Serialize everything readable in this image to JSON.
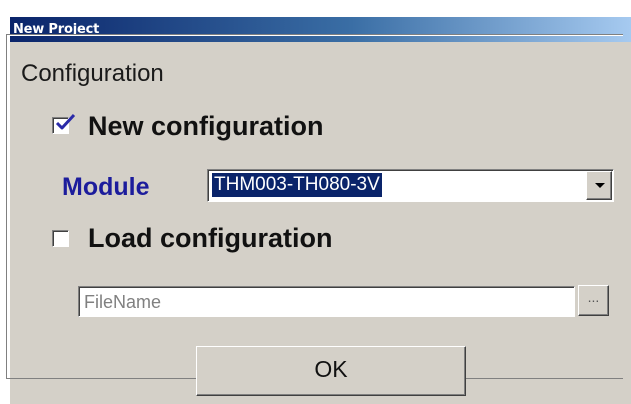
{
  "window": {
    "title": "New Project"
  },
  "group": {
    "label": "Configuration"
  },
  "new_config": {
    "label": "New configuration",
    "checked": true
  },
  "module": {
    "label": "Module",
    "selected": "THM003-TH080-3V"
  },
  "load_config": {
    "label": "Load configuration",
    "checked": false
  },
  "file": {
    "placeholder": "FileName",
    "browse_label": "..."
  },
  "buttons": {
    "ok": "OK"
  },
  "colors": {
    "titlebar_start": "#0a246a",
    "titlebar_end": "#a6caf0",
    "dialog_bg": "#d4d0c8",
    "module_label": "#1c1c9c",
    "selection_bg": "#0a246a",
    "check_mark": "#2a2aa8"
  }
}
